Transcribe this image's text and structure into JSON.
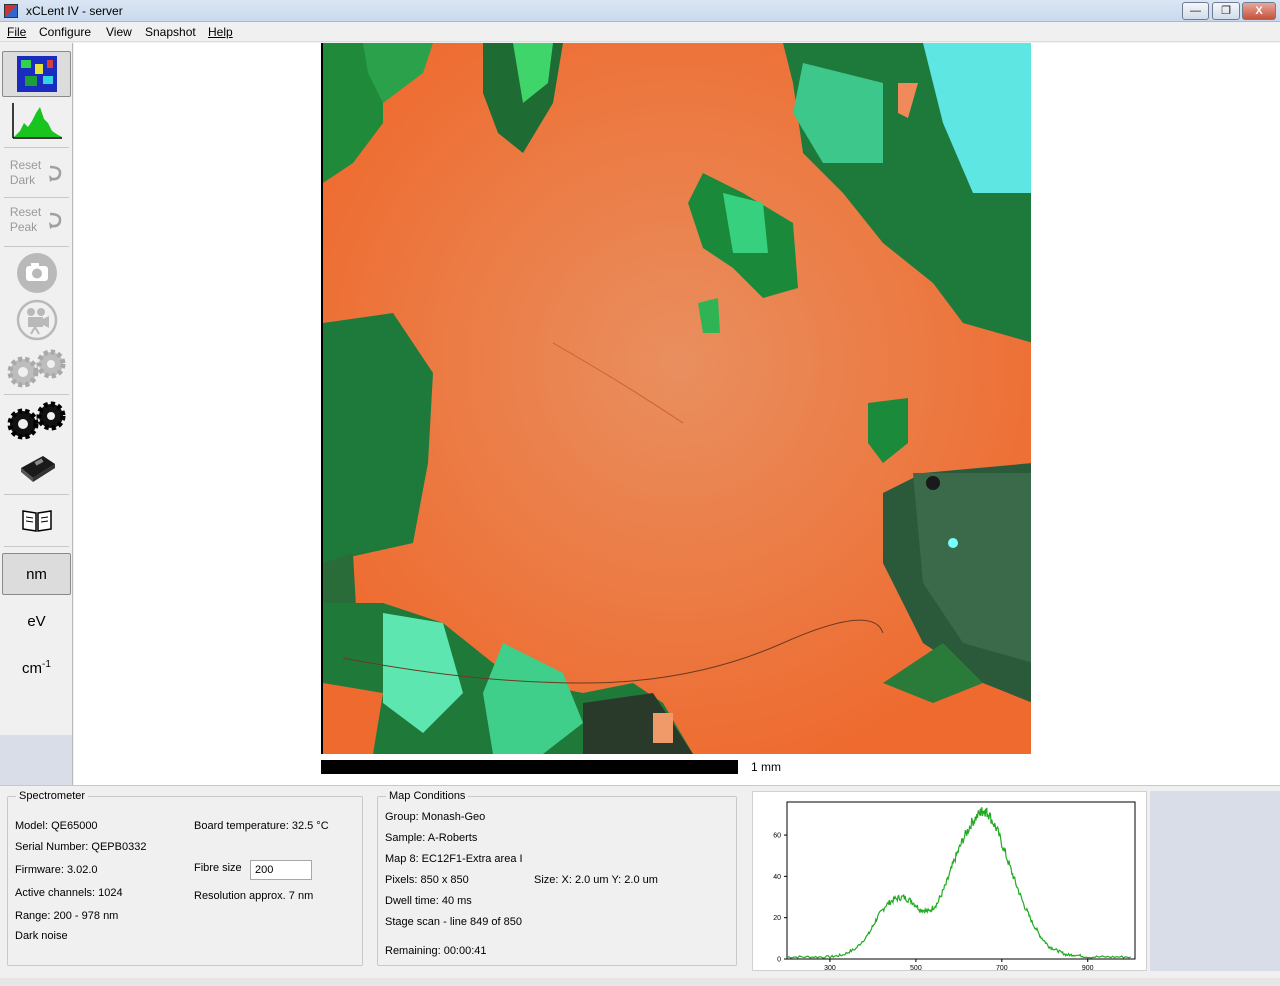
{
  "window": {
    "title": "xCLent IV - server",
    "btn_min": "—",
    "btn_max": "❐",
    "btn_close": "X"
  },
  "menu": {
    "file": "File",
    "configure": "Configure",
    "view": "View",
    "snapshot": "Snapshot",
    "help": "Help"
  },
  "toolbar": {
    "reset_dark_1": "Reset",
    "reset_dark_2": "Dark",
    "reset_peak_1": "Reset",
    "reset_peak_2": "Peak",
    "unit_nm": "nm",
    "unit_ev": "eV",
    "unit_cm": "cm",
    "unit_cm_sup": "-1"
  },
  "map": {
    "scale_label": "1 mm"
  },
  "spectrometer": {
    "title": "Spectrometer",
    "model": "Model: QE65000",
    "serial": "Serial Number: QEPB0332",
    "firmware": "Firmware: 3.02.0",
    "channels": "Active channels: 1024",
    "range": "Range: 200 - 978 nm",
    "dark_noise": "Dark noise",
    "board_temp": "Board temperature: 32.5 °C",
    "fibre_label": "Fibre size",
    "fibre_value": "200",
    "resolution": "Resolution approx. 7 nm"
  },
  "map_conditions": {
    "title": "Map Conditions",
    "group": "Group: Monash-Geo",
    "sample": "Sample: A-Roberts",
    "map": "Map 8: EC12F1-Extra area I",
    "pixels": "Pixels: 850 x 850",
    "size": "Size: X: 2.0 um   Y: 2.0 um",
    "dwell": "Dwell time: 40 ms",
    "stage": "Stage scan - line 849 of 850",
    "remaining": "Remaining: 00:00:41"
  },
  "chart_data": {
    "type": "line",
    "x_ticks": [
      "300",
      "500",
      "700",
      "900"
    ],
    "y_ticks": [
      "0",
      "20",
      "40",
      "60"
    ],
    "xlim": [
      200,
      1010
    ],
    "ylim": [
      0,
      76
    ],
    "series_color": "#22aa22",
    "x": [
      200,
      250,
      300,
      330,
      360,
      390,
      410,
      430,
      450,
      470,
      490,
      510,
      530,
      550,
      570,
      590,
      610,
      630,
      650,
      660,
      670,
      690,
      710,
      730,
      750,
      770,
      790,
      810,
      830,
      850,
      870,
      900,
      950,
      1000
    ],
    "y": [
      1,
      1,
      1,
      2,
      5,
      12,
      20,
      26,
      29,
      30,
      28,
      24,
      23,
      27,
      36,
      48,
      58,
      66,
      71,
      72,
      70,
      62,
      50,
      38,
      27,
      18,
      11,
      6,
      4,
      2,
      2,
      1,
      1,
      1
    ]
  }
}
